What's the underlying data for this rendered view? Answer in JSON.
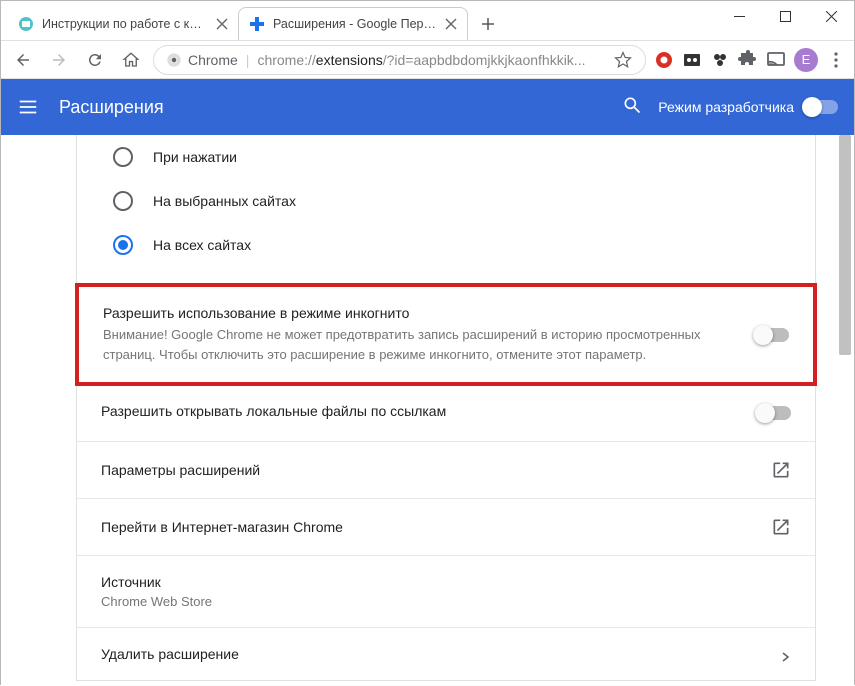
{
  "window": {
    "tabs": [
      {
        "title": "Инструкции по работе с компь",
        "active": false
      },
      {
        "title": "Расширения - Google Перевод",
        "active": true
      }
    ]
  },
  "toolbar": {
    "chrome_label": "Chrome",
    "url_scheme": "chrome://",
    "url_host": "extensions",
    "url_path": "/?id=aapbdbdomjkkjkaonfhkkik...",
    "avatar_letter": "E"
  },
  "appbar": {
    "title": "Расширения",
    "dev_label": "Режим разработчика"
  },
  "radio_options": {
    "opt1": "При нажатии",
    "opt2": "На выбранных сайтах",
    "opt3": "На всех сайтах"
  },
  "incognito": {
    "title": "Разрешить использование в режиме инкогнито",
    "desc": "Внимание! Google Chrome не может предотвратить запись расширений в историю просмотренных страниц. Чтобы отключить это расширение в режиме инкогнито, отмените этот параметр."
  },
  "local_files": {
    "title": "Разрешить открывать локальные файлы по ссылкам"
  },
  "links": {
    "options": "Параметры расширений",
    "webstore": "Перейти в Интернет-магазин Chrome"
  },
  "source": {
    "label": "Источник",
    "value": "Chrome Web Store"
  },
  "remove": {
    "label": "Удалить расширение"
  }
}
